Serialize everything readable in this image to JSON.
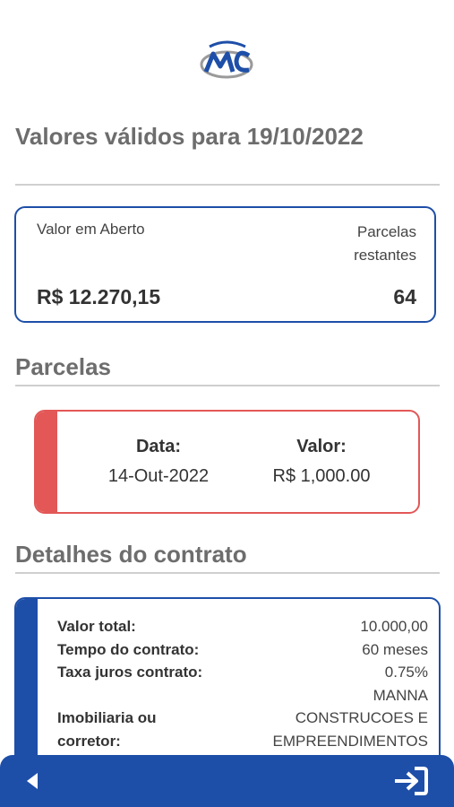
{
  "logo": {
    "icon": "mc-logo-icon",
    "colors": {
      "blue": "#1e4fa8",
      "gray": "#9a9a9a"
    }
  },
  "header": {
    "title": "Valores válidos para 19/10/2022"
  },
  "summary": {
    "open_label": "Valor em Aberto",
    "remaining_label": "Parcelas restantes",
    "open_value": "R$ 12.270,15",
    "remaining_value": "64"
  },
  "parcelas": {
    "title": "Parcelas",
    "date_header": "Data:",
    "value_header": "Valor:",
    "date": "14-Out-2022",
    "value": "R$ 1,000.00",
    "accent": "#e35757"
  },
  "contract": {
    "title": "Detalhes do contrato",
    "rows": [
      {
        "label": "Valor total:",
        "value": "10.000,00"
      },
      {
        "label": "Tempo do contrato:",
        "value": "60 meses"
      },
      {
        "label": "Taxa juros contrato:",
        "value": "0.75%"
      },
      {
        "label": "",
        "value": "MANNA"
      },
      {
        "label": "Imobiliaria ou",
        "value": "CONSTRUCOES E"
      },
      {
        "label": "corretor:",
        "value": "EMPREENDIMENTOS"
      }
    ],
    "accent": "#1e4fa8"
  },
  "bottom_bar": {
    "back_icon": "back-arrow-icon",
    "login_icon": "sign-in-icon",
    "color": "#1e4fa8"
  }
}
